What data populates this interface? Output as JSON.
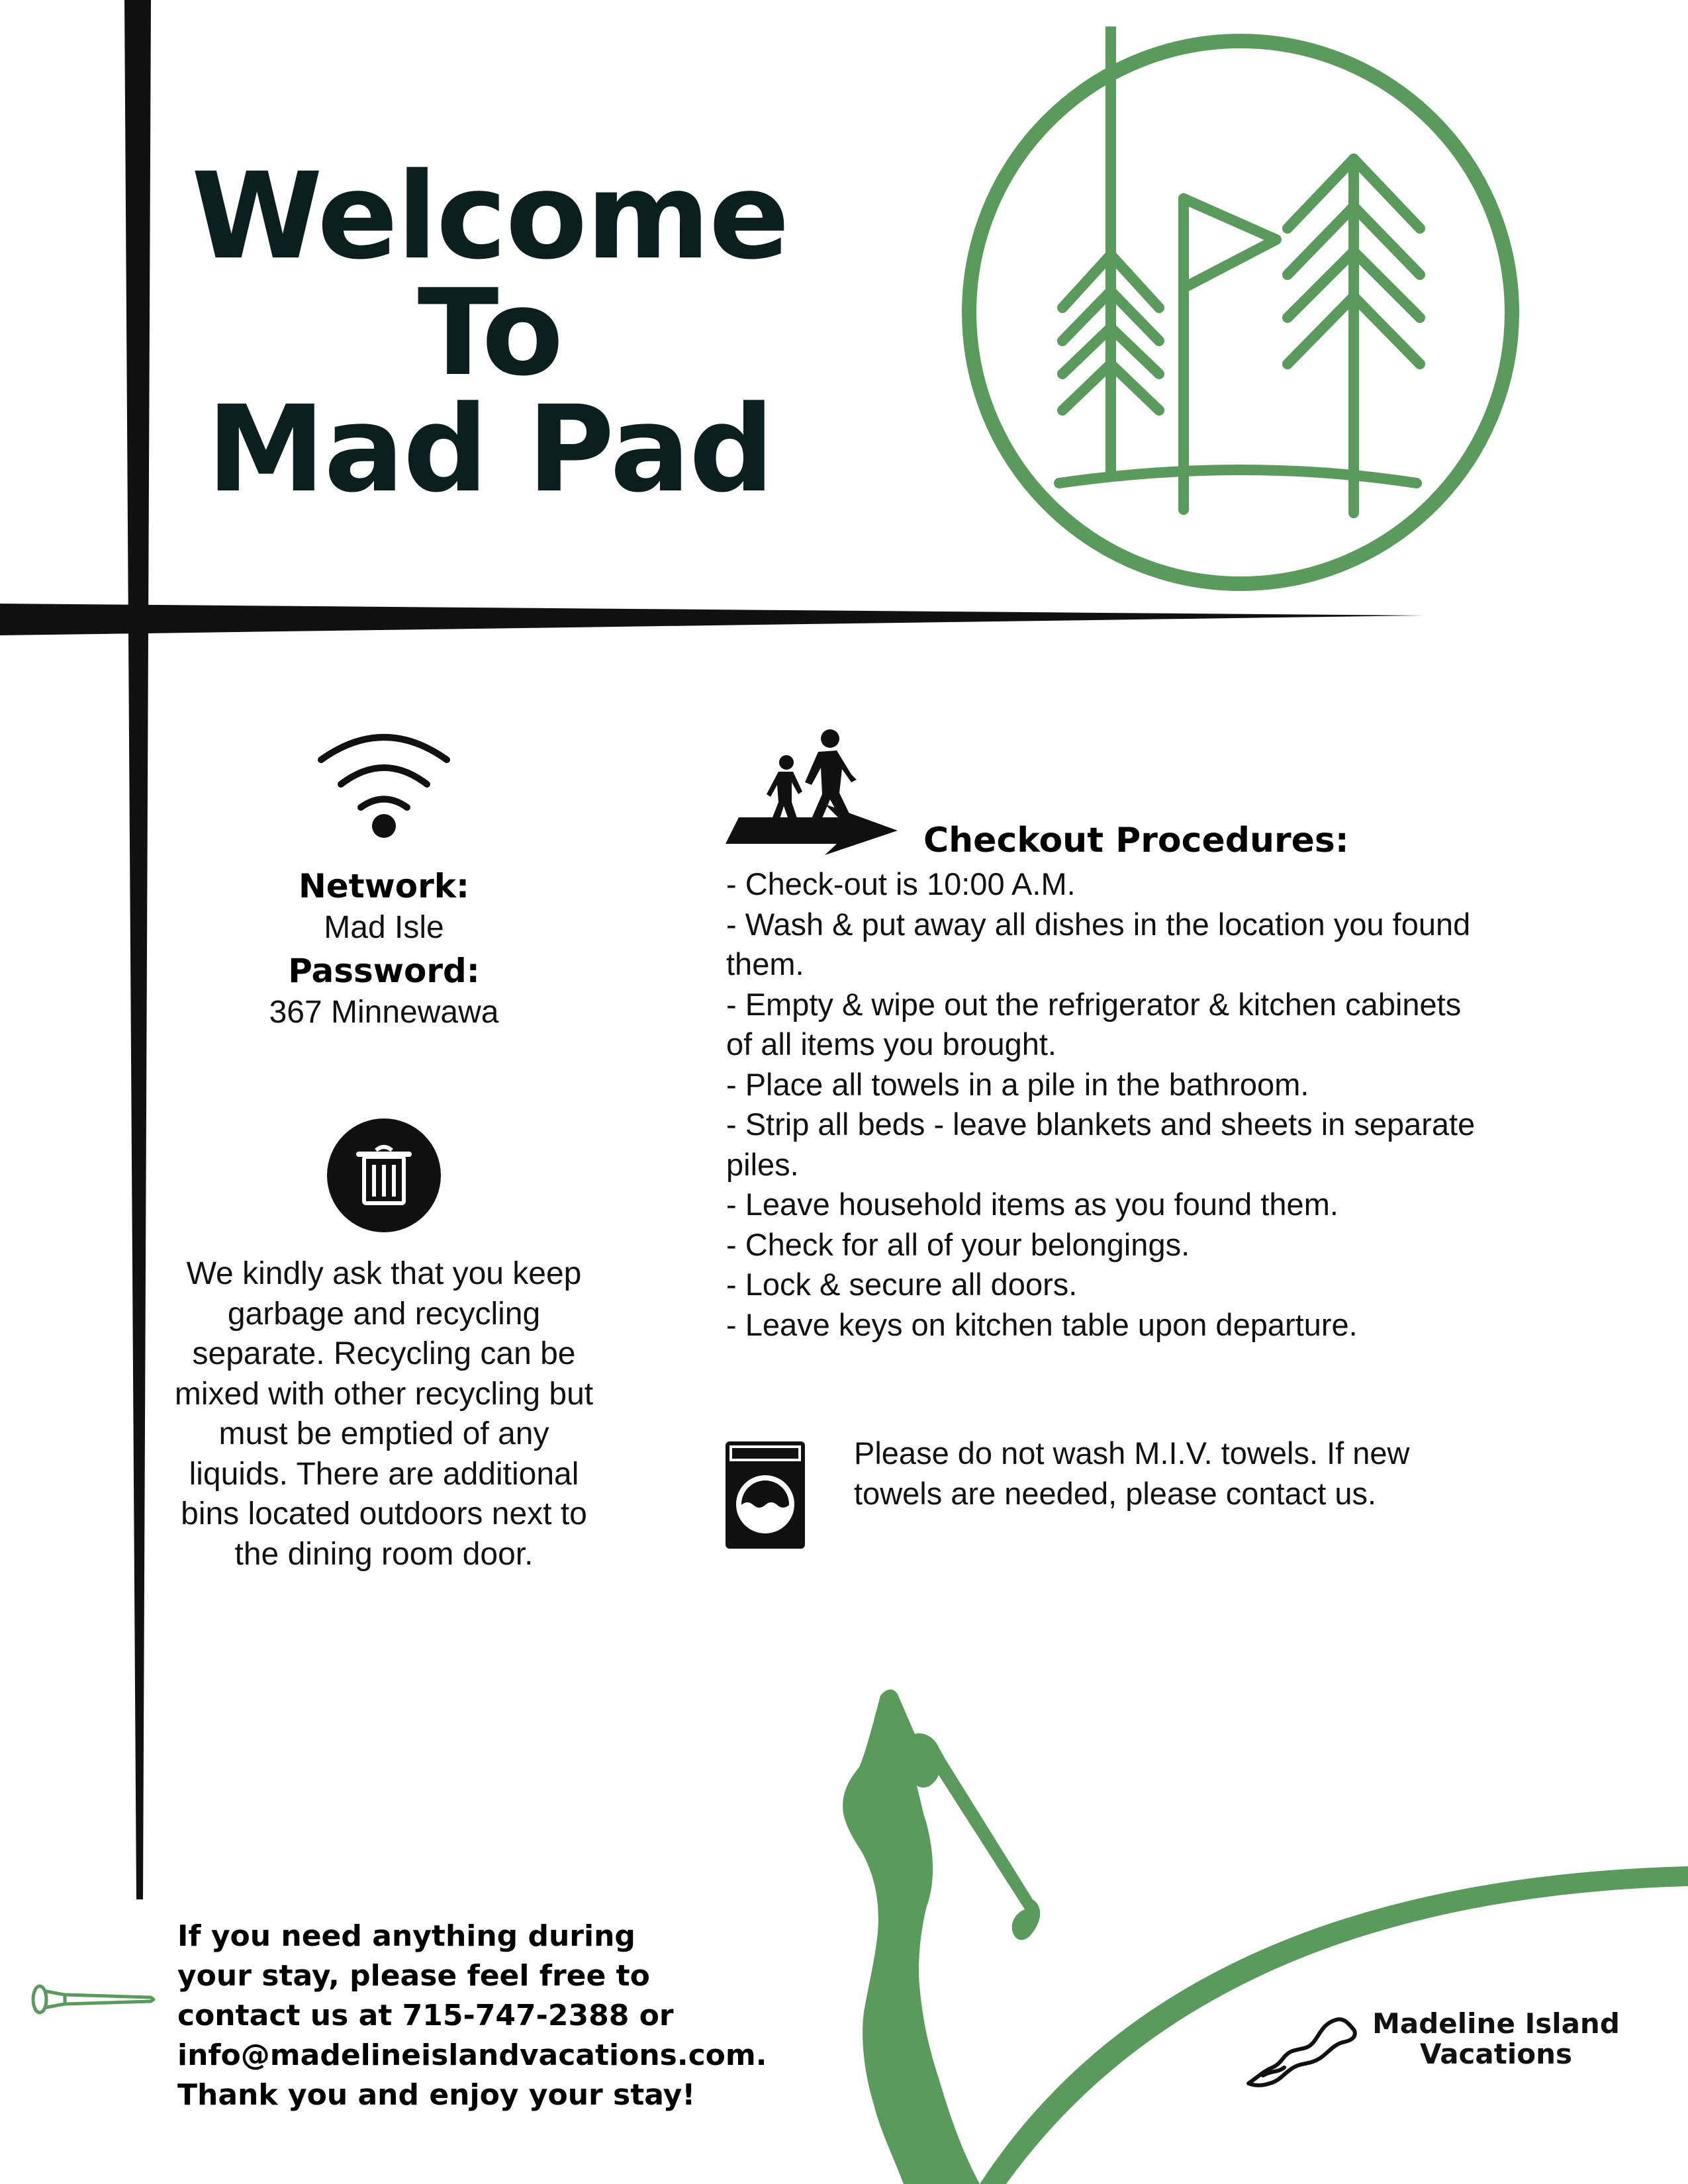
{
  "title": {
    "line1": "Welcome",
    "line2": "To",
    "line3": "Mad Pad"
  },
  "wifi": {
    "network_label": "Network:",
    "network_value": "Mad Isle",
    "password_label": "Password:",
    "password_value": "367 Minnewawa"
  },
  "garbage": {
    "text": "We kindly ask that you keep garbage and recycling separate. Recycling can be mixed with other recycling but must be emptied of any liquids. There are additional bins located outdoors next to the dining room door."
  },
  "checkout": {
    "heading": "Checkout Procedures:",
    "items": [
      "- Check-out is 10:00 A.M.",
      "- Wash & put away all dishes in the location you found them.",
      "- Empty & wipe out the refrigerator & kitchen cabinets of all items you brought.",
      "- Place all towels in a pile in the bathroom.",
      "- Strip all beds - leave blankets and sheets in separate piles.",
      "- Leave household items as you found them.",
      "- Check for all of your belongings.",
      "- Lock & secure all doors.",
      "- Leave keys on kitchen table upon departure."
    ]
  },
  "towels": {
    "text": "Please do not wash M.I.V. towels. If new towels are needed, please contact us."
  },
  "contact": {
    "line1": "If you need anything during",
    "line2": "your stay, please feel free to",
    "line3": "contact us at 715-747-2388 or",
    "line4": "info@madelineislandvacations.com.",
    "line5": "Thank you and enjoy your stay!"
  },
  "brand": {
    "line1": "Madeline Island",
    "line2": "Vacations"
  },
  "colors": {
    "accent_green": "#5a9a5c",
    "title_dark": "#0b1f1f",
    "line_black": "#111111"
  },
  "icons": [
    "wifi-icon",
    "trash-icon",
    "walking-people-icon",
    "washing-machine-icon",
    "golf-trees-logo",
    "golfer-silhouette",
    "golf-tee-icon",
    "island-logo"
  ]
}
